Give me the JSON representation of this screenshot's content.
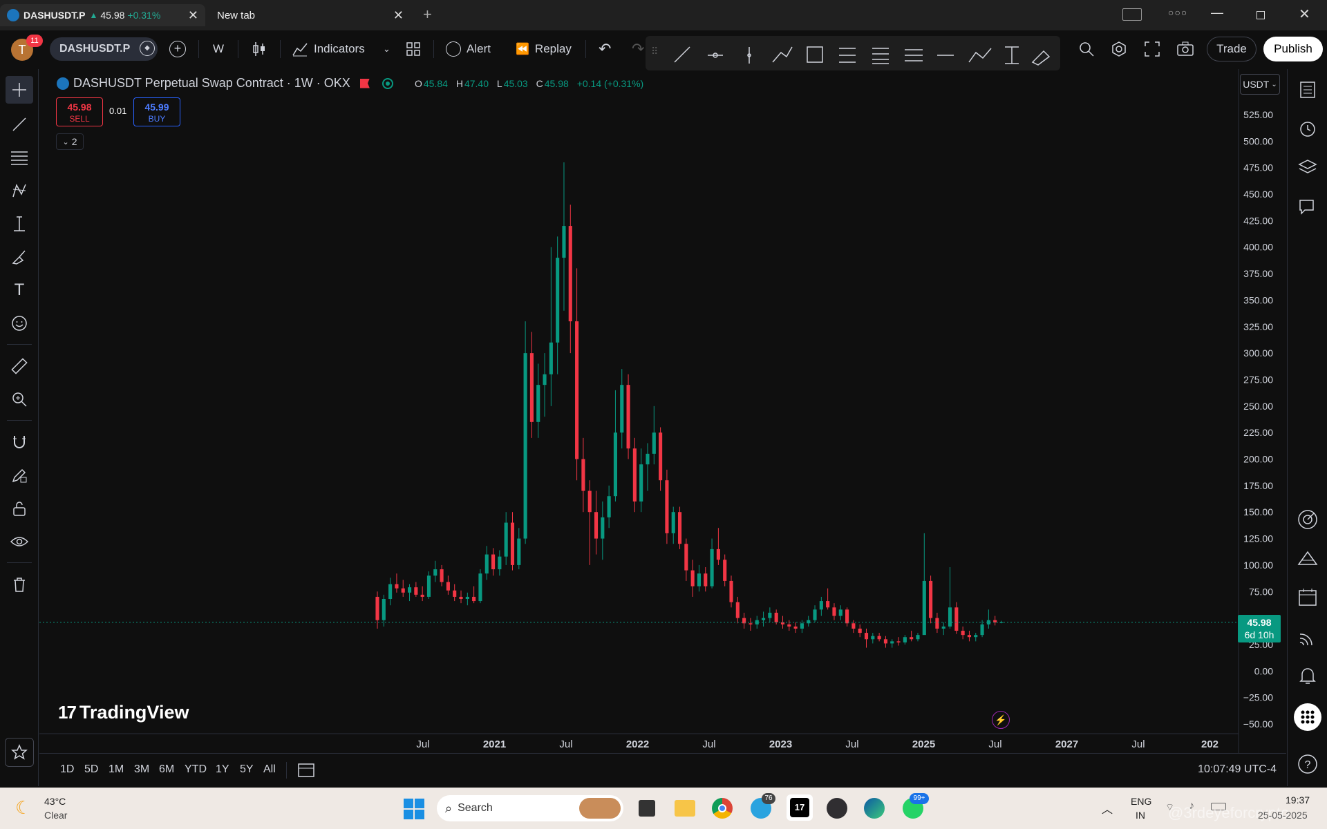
{
  "browser": {
    "tabs": [
      {
        "title": "DASHUSDT.P",
        "price": "45.98",
        "change": "+0.31%"
      },
      {
        "title": "New tab"
      }
    ],
    "new_tab_symbol": "+"
  },
  "toolbar": {
    "avatar_letter": "T",
    "notification_count": "11",
    "symbol": "DASHUSDT.P",
    "interval": "W",
    "indicators_label": "Indicators",
    "alert_label": "Alert",
    "replay_label": "Replay",
    "trade_label": "Trade",
    "publish_label": "Publish"
  },
  "legend": {
    "title": "DASHUSDT Perpetual Swap Contract · 1W · OKX",
    "open_label": "O",
    "open": "45.84",
    "high_label": "H",
    "high": "47.40",
    "low_label": "L",
    "low": "45.03",
    "close_label": "C",
    "close": "45.98",
    "change": "+0.14 (+0.31%)",
    "sell_price": "45.98",
    "sell_label": "SELL",
    "spread": "0.01",
    "buy_price": "45.99",
    "buy_label": "BUY",
    "indicators_count": "2"
  },
  "price_axis": {
    "currency": "USDT",
    "labels": [
      "525.00",
      "500.00",
      "475.00",
      "450.00",
      "425.00",
      "400.00",
      "375.00",
      "350.00",
      "325.00",
      "300.00",
      "275.00",
      "250.00",
      "225.00",
      "200.00",
      "175.00",
      "150.00",
      "125.00",
      "100.00",
      "75.00",
      "50.00",
      "25.00",
      "0.00",
      "−25.00",
      "−50.00"
    ],
    "current_price": "45.98",
    "countdown": "6d 10h"
  },
  "time_axis": {
    "labels": [
      "Jul",
      "2021",
      "Jul",
      "2022",
      "Jul",
      "2023",
      "Jul",
      "2025",
      "Jul",
      "2027",
      "Jul",
      "202"
    ]
  },
  "branding": "TradingView",
  "bottom_bar": {
    "ranges": [
      "1D",
      "5D",
      "1M",
      "3M",
      "6M",
      "YTD",
      "1Y",
      "5Y",
      "All"
    ],
    "clock": "10:07:49 UTC-4"
  },
  "taskbar": {
    "weather_temp": "43°C",
    "weather_desc": "Clear",
    "search_placeholder": "Search",
    "telegram_badge": "76",
    "whatsapp_badge": "99+",
    "lang_top": "ENG",
    "lang_bottom": "IN",
    "time": "19:37",
    "date": "25-05-2025",
    "watermark": "@3rdeyeforcrypto"
  },
  "chart_data": {
    "type": "candlestick",
    "symbol": "DASHUSDT",
    "timeframe": "1W",
    "ylim": [
      -50,
      525
    ],
    "colors": {
      "up": "#089981",
      "down": "#f23645"
    },
    "candles": [
      {
        "o": 70,
        "h": 75,
        "l": 40,
        "c": 48
      },
      {
        "o": 48,
        "h": 72,
        "l": 42,
        "c": 68
      },
      {
        "o": 68,
        "h": 88,
        "l": 62,
        "c": 82
      },
      {
        "o": 82,
        "h": 92,
        "l": 74,
        "c": 78
      },
      {
        "o": 78,
        "h": 86,
        "l": 70,
        "c": 74
      },
      {
        "o": 74,
        "h": 82,
        "l": 66,
        "c": 79
      },
      {
        "o": 79,
        "h": 84,
        "l": 70,
        "c": 72
      },
      {
        "o": 72,
        "h": 80,
        "l": 66,
        "c": 70
      },
      {
        "o": 70,
        "h": 94,
        "l": 68,
        "c": 90
      },
      {
        "o": 90,
        "h": 104,
        "l": 84,
        "c": 96
      },
      {
        "o": 96,
        "h": 100,
        "l": 80,
        "c": 84
      },
      {
        "o": 84,
        "h": 90,
        "l": 72,
        "c": 76
      },
      {
        "o": 76,
        "h": 82,
        "l": 66,
        "c": 70
      },
      {
        "o": 70,
        "h": 76,
        "l": 64,
        "c": 68
      },
      {
        "o": 68,
        "h": 74,
        "l": 62,
        "c": 70
      },
      {
        "o": 70,
        "h": 80,
        "l": 64,
        "c": 66
      },
      {
        "o": 66,
        "h": 96,
        "l": 64,
        "c": 92
      },
      {
        "o": 92,
        "h": 118,
        "l": 86,
        "c": 110
      },
      {
        "o": 110,
        "h": 116,
        "l": 90,
        "c": 96
      },
      {
        "o": 96,
        "h": 114,
        "l": 90,
        "c": 108
      },
      {
        "o": 108,
        "h": 150,
        "l": 100,
        "c": 140
      },
      {
        "o": 140,
        "h": 150,
        "l": 95,
        "c": 100
      },
      {
        "o": 100,
        "h": 135,
        "l": 96,
        "c": 125
      },
      {
        "o": 125,
        "h": 330,
        "l": 120,
        "c": 300
      },
      {
        "o": 300,
        "h": 320,
        "l": 220,
        "c": 235
      },
      {
        "o": 235,
        "h": 290,
        "l": 220,
        "c": 270
      },
      {
        "o": 270,
        "h": 300,
        "l": 240,
        "c": 280
      },
      {
        "o": 280,
        "h": 400,
        "l": 250,
        "c": 310
      },
      {
        "o": 310,
        "h": 410,
        "l": 280,
        "c": 390
      },
      {
        "o": 390,
        "h": 480,
        "l": 340,
        "c": 420
      },
      {
        "o": 420,
        "h": 440,
        "l": 300,
        "c": 330
      },
      {
        "o": 330,
        "h": 380,
        "l": 180,
        "c": 200
      },
      {
        "o": 200,
        "h": 220,
        "l": 150,
        "c": 170
      },
      {
        "o": 170,
        "h": 180,
        "l": 100,
        "c": 150
      },
      {
        "o": 150,
        "h": 170,
        "l": 110,
        "c": 125
      },
      {
        "o": 125,
        "h": 160,
        "l": 105,
        "c": 145
      },
      {
        "o": 145,
        "h": 175,
        "l": 135,
        "c": 165
      },
      {
        "o": 165,
        "h": 265,
        "l": 160,
        "c": 225
      },
      {
        "o": 225,
        "h": 285,
        "l": 210,
        "c": 270
      },
      {
        "o": 270,
        "h": 280,
        "l": 200,
        "c": 210
      },
      {
        "o": 210,
        "h": 220,
        "l": 150,
        "c": 160
      },
      {
        "o": 160,
        "h": 210,
        "l": 150,
        "c": 195
      },
      {
        "o": 195,
        "h": 215,
        "l": 170,
        "c": 205
      },
      {
        "o": 205,
        "h": 250,
        "l": 195,
        "c": 225
      },
      {
        "o": 225,
        "h": 230,
        "l": 170,
        "c": 180
      },
      {
        "o": 180,
        "h": 190,
        "l": 120,
        "c": 130
      },
      {
        "o": 130,
        "h": 155,
        "l": 120,
        "c": 150
      },
      {
        "o": 150,
        "h": 155,
        "l": 115,
        "c": 120
      },
      {
        "o": 120,
        "h": 125,
        "l": 85,
        "c": 95
      },
      {
        "o": 95,
        "h": 105,
        "l": 70,
        "c": 80
      },
      {
        "o": 80,
        "h": 100,
        "l": 75,
        "c": 92
      },
      {
        "o": 92,
        "h": 98,
        "l": 75,
        "c": 80
      },
      {
        "o": 80,
        "h": 125,
        "l": 78,
        "c": 115
      },
      {
        "o": 115,
        "h": 135,
        "l": 100,
        "c": 105
      },
      {
        "o": 105,
        "h": 110,
        "l": 80,
        "c": 85
      },
      {
        "o": 85,
        "h": 90,
        "l": 60,
        "c": 65
      },
      {
        "o": 65,
        "h": 70,
        "l": 45,
        "c": 50
      },
      {
        "o": 50,
        "h": 55,
        "l": 40,
        "c": 45
      },
      {
        "o": 45,
        "h": 50,
        "l": 38,
        "c": 44
      },
      {
        "o": 44,
        "h": 52,
        "l": 40,
        "c": 48
      },
      {
        "o": 48,
        "h": 56,
        "l": 42,
        "c": 50
      },
      {
        "o": 50,
        "h": 60,
        "l": 46,
        "c": 55
      },
      {
        "o": 55,
        "h": 58,
        "l": 44,
        "c": 46
      },
      {
        "o": 46,
        "h": 52,
        "l": 40,
        "c": 44
      },
      {
        "o": 44,
        "h": 48,
        "l": 38,
        "c": 42
      },
      {
        "o": 42,
        "h": 46,
        "l": 36,
        "c": 40
      },
      {
        "o": 40,
        "h": 48,
        "l": 36,
        "c": 45
      },
      {
        "o": 45,
        "h": 52,
        "l": 42,
        "c": 48
      },
      {
        "o": 48,
        "h": 62,
        "l": 46,
        "c": 58
      },
      {
        "o": 58,
        "h": 70,
        "l": 52,
        "c": 66
      },
      {
        "o": 66,
        "h": 78,
        "l": 58,
        "c": 60
      },
      {
        "o": 60,
        "h": 64,
        "l": 48,
        "c": 52
      },
      {
        "o": 52,
        "h": 62,
        "l": 48,
        "c": 58
      },
      {
        "o": 58,
        "h": 60,
        "l": 42,
        "c": 45
      },
      {
        "o": 45,
        "h": 48,
        "l": 36,
        "c": 40
      },
      {
        "o": 40,
        "h": 44,
        "l": 32,
        "c": 36
      },
      {
        "o": 36,
        "h": 40,
        "l": 22,
        "c": 30
      },
      {
        "o": 30,
        "h": 36,
        "l": 26,
        "c": 33
      },
      {
        "o": 33,
        "h": 36,
        "l": 28,
        "c": 30
      },
      {
        "o": 30,
        "h": 33,
        "l": 22,
        "c": 26
      },
      {
        "o": 26,
        "h": 30,
        "l": 22,
        "c": 28
      },
      {
        "o": 28,
        "h": 32,
        "l": 24,
        "c": 27
      },
      {
        "o": 27,
        "h": 34,
        "l": 25,
        "c": 32
      },
      {
        "o": 32,
        "h": 38,
        "l": 28,
        "c": 30
      },
      {
        "o": 30,
        "h": 36,
        "l": 28,
        "c": 34
      },
      {
        "o": 34,
        "h": 130,
        "l": 60,
        "c": 85
      },
      {
        "o": 85,
        "h": 90,
        "l": 45,
        "c": 50
      },
      {
        "o": 50,
        "h": 55,
        "l": 36,
        "c": 40
      },
      {
        "o": 40,
        "h": 46,
        "l": 34,
        "c": 42
      },
      {
        "o": 42,
        "h": 98,
        "l": 40,
        "c": 60
      },
      {
        "o": 60,
        "h": 65,
        "l": 35,
        "c": 38
      },
      {
        "o": 38,
        "h": 42,
        "l": 30,
        "c": 34
      },
      {
        "o": 34,
        "h": 38,
        "l": 28,
        "c": 32
      },
      {
        "o": 32,
        "h": 36,
        "l": 28,
        "c": 34
      },
      {
        "o": 34,
        "h": 48,
        "l": 32,
        "c": 44
      },
      {
        "o": 44,
        "h": 58,
        "l": 40,
        "c": 48
      },
      {
        "o": 48,
        "h": 52,
        "l": 43,
        "c": 45.84
      },
      {
        "o": 45.84,
        "h": 47.4,
        "l": 45.03,
        "c": 45.98
      }
    ]
  }
}
